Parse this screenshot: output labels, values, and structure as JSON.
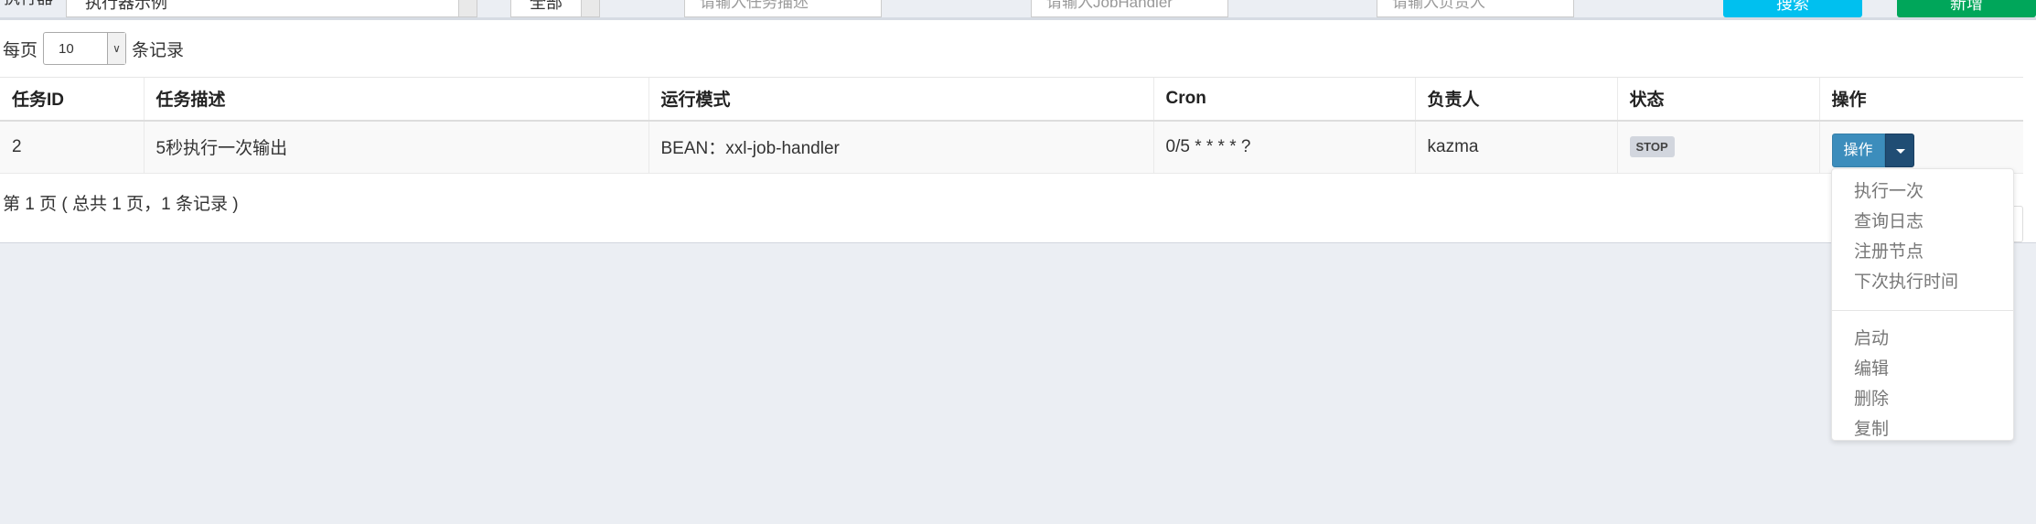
{
  "filters": {
    "executor_label": "执行器",
    "executor_value": "执行器示例",
    "status_value": "全部",
    "desc_placeholder": "请输入任务描述",
    "handler_placeholder": "请输入JobHandler",
    "author_placeholder": "请输入负责人",
    "search_label": "搜索",
    "add_label": "新增"
  },
  "length": {
    "prefix": "每页",
    "value": "10",
    "suffix": "条记录"
  },
  "table": {
    "headers": [
      "任务ID",
      "任务描述",
      "运行模式",
      "Cron",
      "负责人",
      "状态",
      "操作"
    ],
    "rows": [
      {
        "id": "2",
        "desc": "5秒执行一次输出",
        "mode": "BEAN：xxl-job-handler",
        "cron": "0/5 * * * * ?",
        "author": "kazma",
        "status": "STOP",
        "op": "操作"
      }
    ]
  },
  "info": "第 1 页 ( 总共 1 页，1 条记录 )",
  "dropdown": {
    "group1": [
      "执行一次",
      "查询日志",
      "注册节点",
      "下次执行时间"
    ],
    "group2": [
      "启动",
      "编辑",
      "删除",
      "复制"
    ]
  },
  "colors": {
    "primary": "#3c8dbc",
    "search": "#00c0ef",
    "add": "#00a65a",
    "badge": "#d2d6de"
  }
}
